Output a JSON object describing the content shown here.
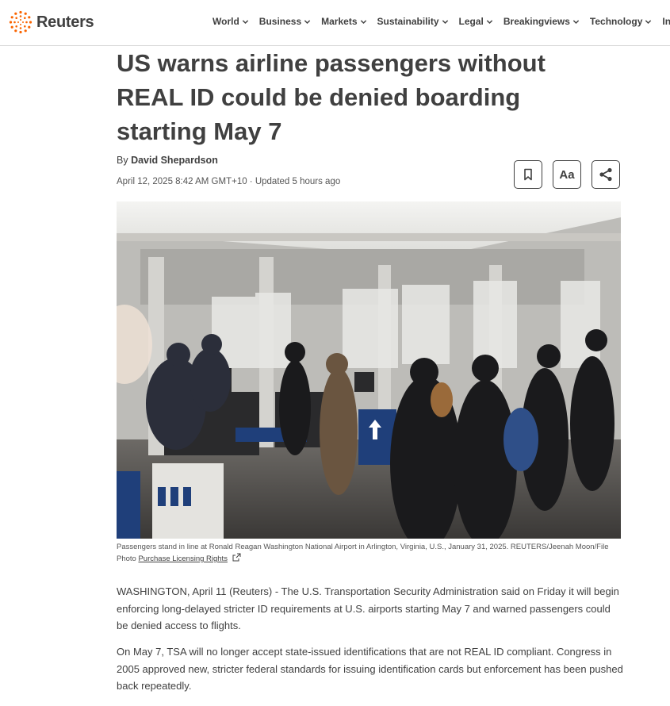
{
  "brand": {
    "name": "Reuters",
    "color": "#fa6400"
  },
  "nav": {
    "items": [
      {
        "label": "World"
      },
      {
        "label": "Business"
      },
      {
        "label": "Markets"
      },
      {
        "label": "Sustainability"
      },
      {
        "label": "Legal"
      },
      {
        "label": "Breakingviews"
      },
      {
        "label": "Technology"
      },
      {
        "label": "Inve"
      }
    ]
  },
  "article": {
    "headline": "US warns airline passengers without REAL ID could be denied boarding starting May 7",
    "byline_prefix": "By",
    "author": "David Shepardson",
    "dateline": "April 12, 2025 8:42 AM GMT+10 · Updated 5 hours ago",
    "tools": {
      "bookmark_icon": "bookmark-icon",
      "text_size_label": "Aa",
      "share_icon": "share-icon"
    },
    "caption": "Passengers stand in line at Ronald Reagan Washington National Airport in Arlington, Virginia, U.S., January 31, 2025. REUTERS/Jeenah Moon/File Photo",
    "caption_link": "Purchase Licensing Rights",
    "paragraphs": [
      "WASHINGTON, April 11 (Reuters) - The U.S. Transportation Security Administration said on Friday it will begin enforcing long-delayed stricter ID requirements at U.S. airports starting May 7 and warned passengers could be denied access to flights.",
      "On May 7, TSA will no longer accept state-issued identifications that are not REAL ID compliant. Congress in 2005 approved new, stricter federal standards for issuing identification cards but enforcement has been pushed back repeatedly."
    ]
  }
}
